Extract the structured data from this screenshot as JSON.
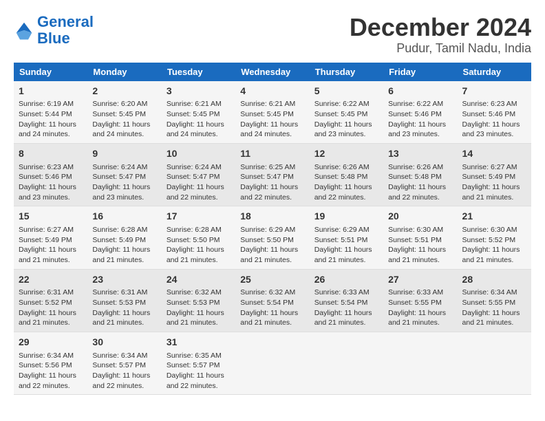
{
  "logo": {
    "line1": "General",
    "line2": "Blue"
  },
  "title": "December 2024",
  "subtitle": "Pudur, Tamil Nadu, India",
  "days_of_week": [
    "Sunday",
    "Monday",
    "Tuesday",
    "Wednesday",
    "Thursday",
    "Friday",
    "Saturday"
  ],
  "weeks": [
    [
      {
        "date": "1",
        "text": "Sunrise: 6:19 AM\nSunset: 5:44 PM\nDaylight: 11 hours and 24 minutes."
      },
      {
        "date": "2",
        "text": "Sunrise: 6:20 AM\nSunset: 5:45 PM\nDaylight: 11 hours and 24 minutes."
      },
      {
        "date": "3",
        "text": "Sunrise: 6:21 AM\nSunset: 5:45 PM\nDaylight: 11 hours and 24 minutes."
      },
      {
        "date": "4",
        "text": "Sunrise: 6:21 AM\nSunset: 5:45 PM\nDaylight: 11 hours and 24 minutes."
      },
      {
        "date": "5",
        "text": "Sunrise: 6:22 AM\nSunset: 5:45 PM\nDaylight: 11 hours and 23 minutes."
      },
      {
        "date": "6",
        "text": "Sunrise: 6:22 AM\nSunset: 5:46 PM\nDaylight: 11 hours and 23 minutes."
      },
      {
        "date": "7",
        "text": "Sunrise: 6:23 AM\nSunset: 5:46 PM\nDaylight: 11 hours and 23 minutes."
      }
    ],
    [
      {
        "date": "8",
        "text": "Sunrise: 6:23 AM\nSunset: 5:46 PM\nDaylight: 11 hours and 23 minutes."
      },
      {
        "date": "9",
        "text": "Sunrise: 6:24 AM\nSunset: 5:47 PM\nDaylight: 11 hours and 23 minutes."
      },
      {
        "date": "10",
        "text": "Sunrise: 6:24 AM\nSunset: 5:47 PM\nDaylight: 11 hours and 22 minutes."
      },
      {
        "date": "11",
        "text": "Sunrise: 6:25 AM\nSunset: 5:47 PM\nDaylight: 11 hours and 22 minutes."
      },
      {
        "date": "12",
        "text": "Sunrise: 6:26 AM\nSunset: 5:48 PM\nDaylight: 11 hours and 22 minutes."
      },
      {
        "date": "13",
        "text": "Sunrise: 6:26 AM\nSunset: 5:48 PM\nDaylight: 11 hours and 22 minutes."
      },
      {
        "date": "14",
        "text": "Sunrise: 6:27 AM\nSunset: 5:49 PM\nDaylight: 11 hours and 21 minutes."
      }
    ],
    [
      {
        "date": "15",
        "text": "Sunrise: 6:27 AM\nSunset: 5:49 PM\nDaylight: 11 hours and 21 minutes."
      },
      {
        "date": "16",
        "text": "Sunrise: 6:28 AM\nSunset: 5:49 PM\nDaylight: 11 hours and 21 minutes."
      },
      {
        "date": "17",
        "text": "Sunrise: 6:28 AM\nSunset: 5:50 PM\nDaylight: 11 hours and 21 minutes."
      },
      {
        "date": "18",
        "text": "Sunrise: 6:29 AM\nSunset: 5:50 PM\nDaylight: 11 hours and 21 minutes."
      },
      {
        "date": "19",
        "text": "Sunrise: 6:29 AM\nSunset: 5:51 PM\nDaylight: 11 hours and 21 minutes."
      },
      {
        "date": "20",
        "text": "Sunrise: 6:30 AM\nSunset: 5:51 PM\nDaylight: 11 hours and 21 minutes."
      },
      {
        "date": "21",
        "text": "Sunrise: 6:30 AM\nSunset: 5:52 PM\nDaylight: 11 hours and 21 minutes."
      }
    ],
    [
      {
        "date": "22",
        "text": "Sunrise: 6:31 AM\nSunset: 5:52 PM\nDaylight: 11 hours and 21 minutes."
      },
      {
        "date": "23",
        "text": "Sunrise: 6:31 AM\nSunset: 5:53 PM\nDaylight: 11 hours and 21 minutes."
      },
      {
        "date": "24",
        "text": "Sunrise: 6:32 AM\nSunset: 5:53 PM\nDaylight: 11 hours and 21 minutes."
      },
      {
        "date": "25",
        "text": "Sunrise: 6:32 AM\nSunset: 5:54 PM\nDaylight: 11 hours and 21 minutes."
      },
      {
        "date": "26",
        "text": "Sunrise: 6:33 AM\nSunset: 5:54 PM\nDaylight: 11 hours and 21 minutes."
      },
      {
        "date": "27",
        "text": "Sunrise: 6:33 AM\nSunset: 5:55 PM\nDaylight: 11 hours and 21 minutes."
      },
      {
        "date": "28",
        "text": "Sunrise: 6:34 AM\nSunset: 5:55 PM\nDaylight: 11 hours and 21 minutes."
      }
    ],
    [
      {
        "date": "29",
        "text": "Sunrise: 6:34 AM\nSunset: 5:56 PM\nDaylight: 11 hours and 22 minutes."
      },
      {
        "date": "30",
        "text": "Sunrise: 6:34 AM\nSunset: 5:57 PM\nDaylight: 11 hours and 22 minutes."
      },
      {
        "date": "31",
        "text": "Sunrise: 6:35 AM\nSunset: 5:57 PM\nDaylight: 11 hours and 22 minutes."
      },
      {
        "date": "",
        "text": ""
      },
      {
        "date": "",
        "text": ""
      },
      {
        "date": "",
        "text": ""
      },
      {
        "date": "",
        "text": ""
      }
    ]
  ]
}
